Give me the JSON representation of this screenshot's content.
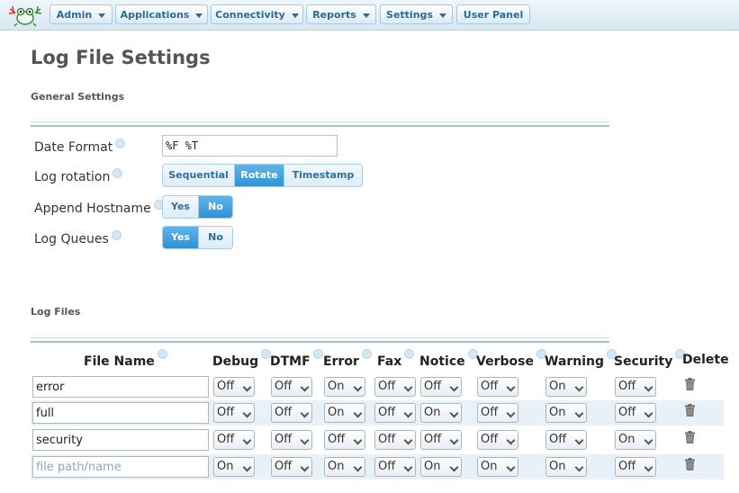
{
  "nav": {
    "menus": [
      {
        "label": "Admin",
        "dropdown": true
      },
      {
        "label": "Applications",
        "dropdown": true
      },
      {
        "label": "Connectivity",
        "dropdown": true
      },
      {
        "label": "Reports",
        "dropdown": true
      },
      {
        "label": "Settings",
        "dropdown": true
      },
      {
        "label": "User Panel",
        "dropdown": false
      }
    ]
  },
  "page_title": "Log File Settings",
  "general": {
    "title": "General Settings",
    "date_format": {
      "label": "Date Format",
      "value": "%F %T"
    },
    "log_rotation": {
      "label": "Log rotation",
      "options": [
        "Sequential",
        "Rotate",
        "Timestamp"
      ],
      "selected": "Rotate"
    },
    "append_hostname": {
      "label": "Append Hostname",
      "options": [
        "Yes",
        "No"
      ],
      "selected": "No"
    },
    "log_queues": {
      "label": "Log Queues",
      "options": [
        "Yes",
        "No"
      ],
      "selected": "Yes"
    }
  },
  "log_files": {
    "title": "Log Files",
    "columns": [
      "File Name",
      "Debug",
      "DTMF",
      "Error",
      "Fax",
      "Notice",
      "Verbose",
      "Warning",
      "Security",
      "Delete"
    ],
    "placeholder": "file path/name",
    "rows": [
      {
        "file": "error",
        "values": [
          "Off",
          "Off",
          "On",
          "Off",
          "Off",
          "Off",
          "On",
          "Off"
        ]
      },
      {
        "file": "full",
        "values": [
          "Off",
          "Off",
          "On",
          "Off",
          "On",
          "Off",
          "On",
          "Off"
        ]
      },
      {
        "file": "security",
        "values": [
          "Off",
          "Off",
          "Off",
          "Off",
          "Off",
          "Off",
          "Off",
          "On"
        ]
      },
      {
        "file": "",
        "values": [
          "On",
          "Off",
          "On",
          "Off",
          "On",
          "On",
          "On",
          "Off"
        ]
      }
    ]
  },
  "colors": {
    "accent": "#2d93d6",
    "nav_text": "#2b6b96",
    "row_alt": "#e8f1f8"
  }
}
